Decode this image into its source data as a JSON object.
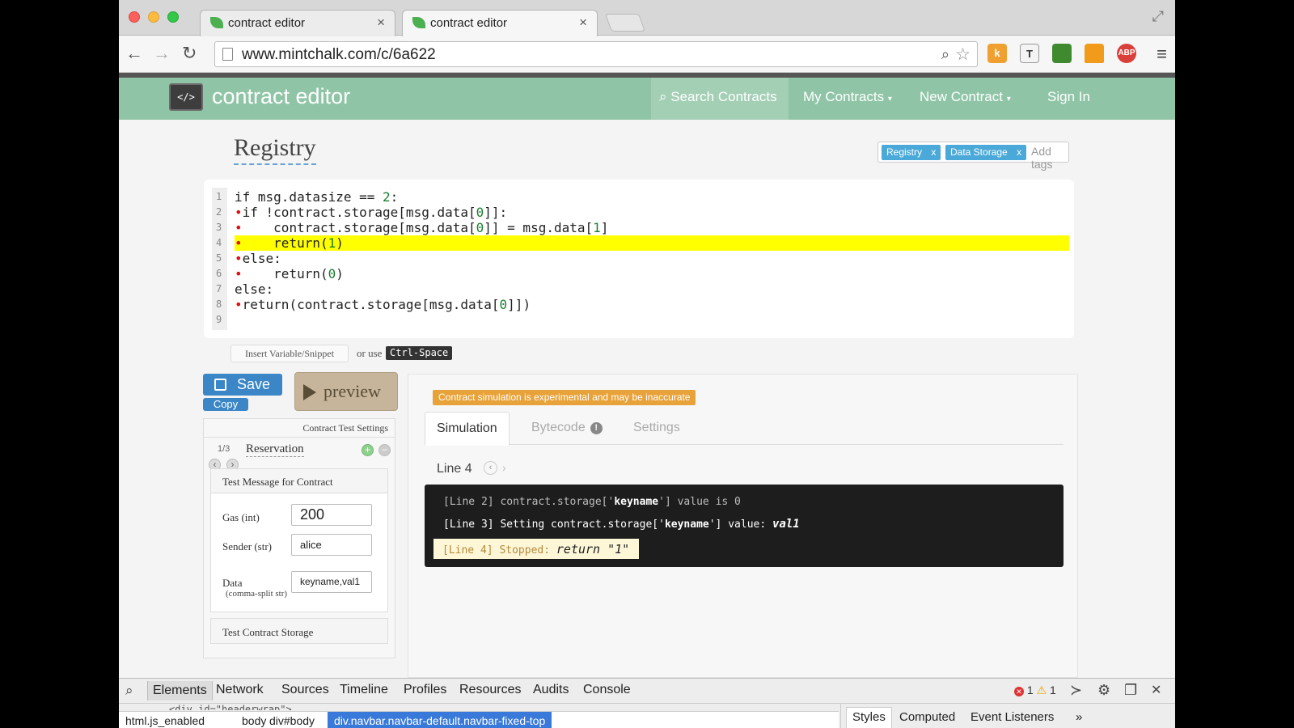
{
  "browser": {
    "tabs": [
      {
        "label": "contract editor",
        "close": "×"
      },
      {
        "label": "contract editor",
        "close": "×"
      }
    ],
    "url": "www.mintchalk.com/c/6a622",
    "extensions": [
      "k",
      "T",
      "",
      "",
      "ABP"
    ]
  },
  "navbar": {
    "logo_glyph": "</>",
    "brand": "contract editor",
    "search": "Search Contracts",
    "my_contracts": "My Contracts",
    "new_contract": "New Contract",
    "sign_in": "Sign In"
  },
  "page": {
    "title": "Registry",
    "tags": [
      "Registry",
      "Data Storage"
    ],
    "tag_remove": "x",
    "add_tags_placeholder": "Add tags"
  },
  "editor": {
    "line_numbers": [
      "1",
      "2",
      "3",
      "4",
      "5",
      "6",
      "7",
      "8",
      "9"
    ],
    "highlight_line": 4
  },
  "snippet": {
    "insert_label": "Insert Variable/Snippet",
    "or_use": "or use",
    "shortcut": "Ctrl-Space"
  },
  "actions": {
    "save": "Save",
    "copy": "Copy",
    "preview": "preview"
  },
  "test_settings": {
    "heading": "Contract Test Settings",
    "counter": "1/3",
    "reservation": "Reservation",
    "message_heading": "Test Message for Contract",
    "gas_label": "Gas (int)",
    "gas_value": "200",
    "sender_label": "Sender (str)",
    "sender_value": "alice",
    "data_label": "Data",
    "data_sublabel": "(comma-split str)",
    "data_value": "keyname,val1",
    "storage_heading": "Test Contract Storage"
  },
  "simulation": {
    "warning": "Contract simulation is experimental and may be inaccurate",
    "tabs": [
      "Simulation",
      "Bytecode",
      "Settings"
    ],
    "bytecode_badge": "!",
    "line_label": "Line 4",
    "console": {
      "line2_prefix": "[Line 2] contract.storage['",
      "line2_key": "keyname",
      "line2_suffix": "'] value is 0",
      "line3_prefix": "[Line 3] Setting contract.storage['",
      "line3_key": "keyname",
      "line3_mid": "'] value: ",
      "line3_val": "val1",
      "line4_prefix": "[Line 4] Stopped: ",
      "line4_val": "return \"1\""
    }
  },
  "devtools": {
    "tabs": [
      "Elements",
      "Network",
      "Sources",
      "Timeline",
      "Profiles",
      "Resources",
      "Audits",
      "Console"
    ],
    "error_count": "1",
    "warning_count": "1",
    "code_peek": "<div id=\"headerwrap\">",
    "breadcrumbs": [
      "html.js_enabled",
      "body",
      "div#body",
      "div.navbar.navbar-default.navbar-fixed-top"
    ],
    "side_tabs": [
      "Styles",
      "Computed",
      "Event Listeners"
    ],
    "more": "»"
  },
  "colors": {
    "navbar": "#8fc5a6",
    "accent_blue": "#3a86c6",
    "highlight": "#ffff00",
    "warning": "#e8a23a"
  }
}
